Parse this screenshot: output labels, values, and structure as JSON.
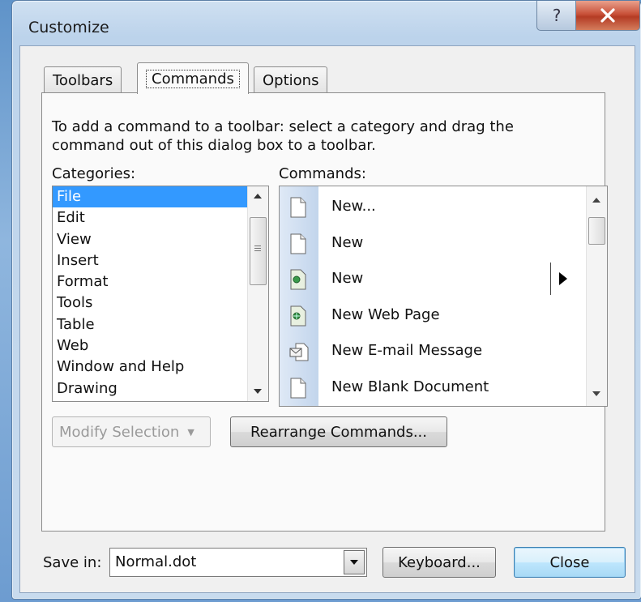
{
  "dialog": {
    "title": "Customize",
    "help_glyph": "?",
    "close_glyph": "✕"
  },
  "tabs": [
    {
      "label": "Toolbars",
      "active": false
    },
    {
      "label": "Commands",
      "active": true
    },
    {
      "label": "Options",
      "active": false
    }
  ],
  "commands_tab": {
    "instructions": "To add a command to a toolbar: select a category and drag the command out of this dialog box to a toolbar.",
    "categories_label": "Categories:",
    "commands_label": "Commands:",
    "categories": [
      "File",
      "Edit",
      "View",
      "Insert",
      "Format",
      "Tools",
      "Table",
      "Web",
      "Window and Help",
      "Drawing"
    ],
    "selected_category": "File",
    "commands": [
      {
        "label": "New...",
        "icon": "blank-page-icon",
        "submenu": false
      },
      {
        "label": "New",
        "icon": "blank-page-icon",
        "submenu": false
      },
      {
        "label": "New",
        "icon": "template-page-icon",
        "submenu": true
      },
      {
        "label": "New Web Page",
        "icon": "web-page-icon",
        "submenu": false
      },
      {
        "label": "New E-mail Message",
        "icon": "email-message-icon",
        "submenu": false
      },
      {
        "label": "New Blank Document",
        "icon": "blank-page-icon",
        "submenu": false
      }
    ],
    "modify_selection": "Modify Selection",
    "rearrange": "Rearrange Commands..."
  },
  "footer": {
    "save_in_label": "Save in:",
    "save_in_value": "Normal.dot",
    "keyboard": "Keyboard...",
    "close": "Close"
  },
  "colors": {
    "selection": "#3399ff",
    "close_button": "#c9523a"
  }
}
